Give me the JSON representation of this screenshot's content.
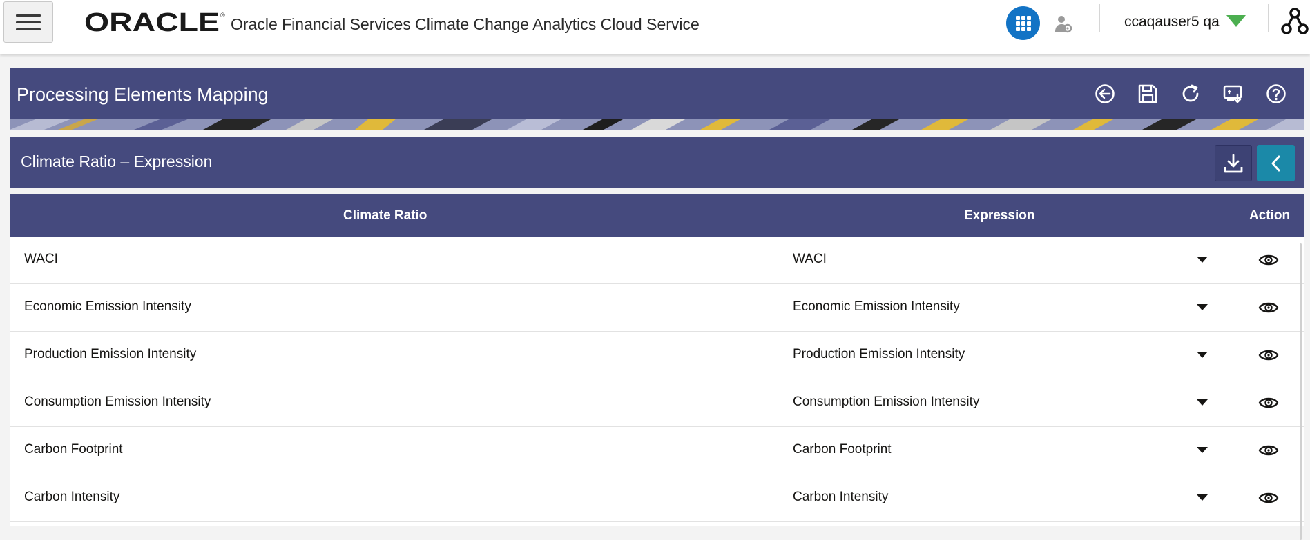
{
  "header": {
    "brand": "ORACLE",
    "app_title": "Oracle Financial Services Climate Change Analytics Cloud Service",
    "username": "ccaqauser5 qa"
  },
  "page": {
    "title": "Processing Elements Mapping"
  },
  "section": {
    "title": "Climate Ratio – Expression"
  },
  "table": {
    "columns": [
      "Climate Ratio",
      "Expression",
      "Action"
    ],
    "rows": [
      {
        "ratio": "WACI",
        "expression": "WACI"
      },
      {
        "ratio": "Economic Emission Intensity",
        "expression": "Economic Emission Intensity"
      },
      {
        "ratio": "Production Emission Intensity",
        "expression": "Production Emission Intensity"
      },
      {
        "ratio": "Consumption Emission Intensity",
        "expression": "Consumption Emission Intensity"
      },
      {
        "ratio": "Carbon Footprint",
        "expression": "Carbon Footprint"
      },
      {
        "ratio": "Carbon Intensity",
        "expression": "Carbon Intensity"
      }
    ]
  },
  "colors": {
    "header_bar": "#454a7e",
    "apps_button": "#1273c5",
    "collapse_button": "#1b89a8",
    "user_caret": "#4caf50"
  }
}
